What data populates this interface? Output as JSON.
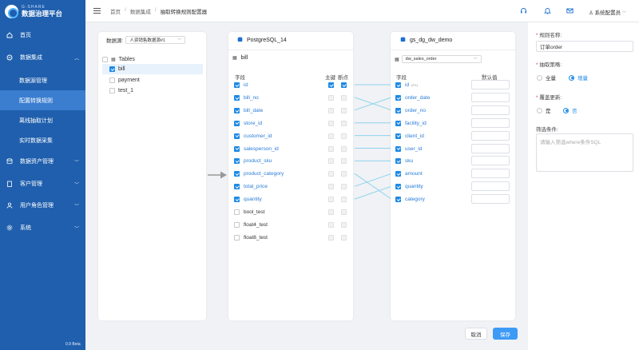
{
  "app": {
    "logo_sub": "G-SHARE",
    "logo_main": "数据治理平台",
    "version": "0.9 Beta"
  },
  "sidebar": {
    "items": [
      {
        "label": "首页",
        "icon": "home-icon"
      },
      {
        "label": "数据集成",
        "icon": "integration-icon",
        "expanded": true
      },
      {
        "label": "数据资产管理",
        "icon": "database-icon"
      },
      {
        "label": "客户管理",
        "icon": "building-icon"
      },
      {
        "label": "用户角色管理",
        "icon": "user-icon"
      },
      {
        "label": "系统",
        "icon": "gear-icon"
      }
    ],
    "sub_items": [
      "数据源管理",
      "配置转换规则",
      "离线抽取计划",
      "实时数据采集"
    ],
    "active_sub": "配置转换规则"
  },
  "topbar": {
    "breadcrumb": [
      "首页",
      "数据集成",
      "抽取转换规则配置器"
    ],
    "user": "系统配置员"
  },
  "source_panel": {
    "datasource_label": "数据源:",
    "datasource_value": "人资销售数据源#1",
    "tree_root": "Tables",
    "tables": [
      "bill",
      "payment",
      "test_1"
    ],
    "selected_table": "bill"
  },
  "left_table": {
    "db_name": "PostgreSQL_14",
    "table_name": "bill",
    "col_field": "字段",
    "col_pk": "主键",
    "col_bp": "断点",
    "fields": [
      {
        "name": "id",
        "checked": true,
        "pk": true,
        "bp": true
      },
      {
        "name": "bill_no",
        "checked": true
      },
      {
        "name": "bill_date",
        "checked": true
      },
      {
        "name": "store_id",
        "checked": true
      },
      {
        "name": "customer_id",
        "checked": true
      },
      {
        "name": "salesperson_id",
        "checked": true
      },
      {
        "name": "product_sku",
        "checked": true
      },
      {
        "name": "product_category",
        "checked": true
      },
      {
        "name": "total_price",
        "checked": true
      },
      {
        "name": "quantity",
        "checked": true
      },
      {
        "name": "bool_test",
        "checked": false
      },
      {
        "name": "float4_test",
        "checked": false
      },
      {
        "name": "float8_test",
        "checked": false
      }
    ]
  },
  "right_table": {
    "db_name": "gs_dg_dw_demo",
    "table_select": "dw_sales_order",
    "col_field": "字段",
    "col_default": "默认值",
    "pk_mark": "(PK)",
    "fields": [
      "id",
      "order_date",
      "order_no",
      "facility_id",
      "client_id",
      "user_id",
      "sku",
      "amount",
      "quantity",
      "category"
    ]
  },
  "mappings": [
    [
      0,
      0
    ],
    [
      1,
      2
    ],
    [
      2,
      1
    ],
    [
      3,
      3
    ],
    [
      4,
      4
    ],
    [
      5,
      5
    ],
    [
      6,
      6
    ],
    [
      7,
      9
    ],
    [
      8,
      7
    ],
    [
      9,
      8
    ]
  ],
  "form": {
    "rule_name_label": "规则名称:",
    "rule_name_value": "订单order",
    "strategy_label": "抽取策略:",
    "strategy_options": [
      "全量",
      "增量"
    ],
    "strategy_selected": "增量",
    "overwrite_label": "覆盖更新:",
    "overwrite_options": [
      "是",
      "否"
    ],
    "overwrite_selected": "否",
    "filter_label": "筛选条件:",
    "filter_placeholder": "请输入筛选where条件SQL"
  },
  "buttons": {
    "cancel": "取消",
    "save": "保存"
  },
  "colors": {
    "sidebar": "#1f5fad",
    "accent": "#1e8ae6",
    "link": "#2a7cd8",
    "line": "#8fd3ec"
  }
}
